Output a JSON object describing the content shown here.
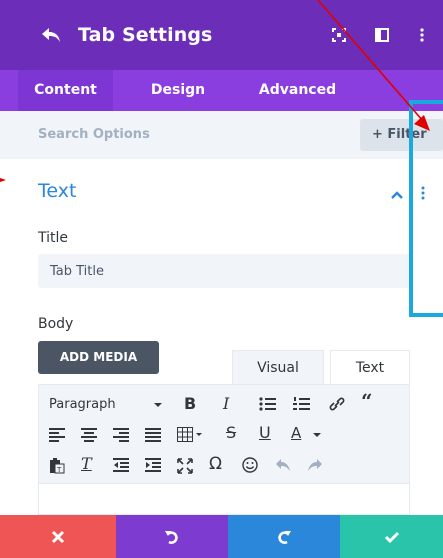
{
  "header": {
    "title": "Tab Settings",
    "background": "#6c2eb9",
    "icons": [
      "back-arrow-icon",
      "expand-icon",
      "split-view-icon",
      "more-vertical-icon"
    ]
  },
  "tabs": [
    {
      "label": "Content",
      "active": true
    },
    {
      "label": "Design",
      "active": false
    },
    {
      "label": "Advanced",
      "active": false
    }
  ],
  "search": {
    "placeholder": "Search Options",
    "filter_label": "+ Filter"
  },
  "section": {
    "title": "Text",
    "accent": "#2b87da"
  },
  "title_field": {
    "label": "Title",
    "value": "Tab Title"
  },
  "body_field": {
    "label": "Body",
    "add_media": "ADD MEDIA",
    "editor_tabs": [
      "Visual",
      "Text"
    ],
    "format_select": "Paragraph"
  },
  "bottom_bar": [
    {
      "action": "cancel",
      "color": "#ef5555",
      "icon": "close-icon"
    },
    {
      "action": "undo",
      "color": "#7e3bd0",
      "icon": "undo-icon"
    },
    {
      "action": "redo",
      "color": "#2b87da",
      "icon": "redo-icon"
    },
    {
      "action": "save",
      "color": "#29c4a9",
      "icon": "check-icon"
    }
  ],
  "annotation": {
    "arrow_color": "#e00000",
    "box_color": "#1ba7e0"
  }
}
